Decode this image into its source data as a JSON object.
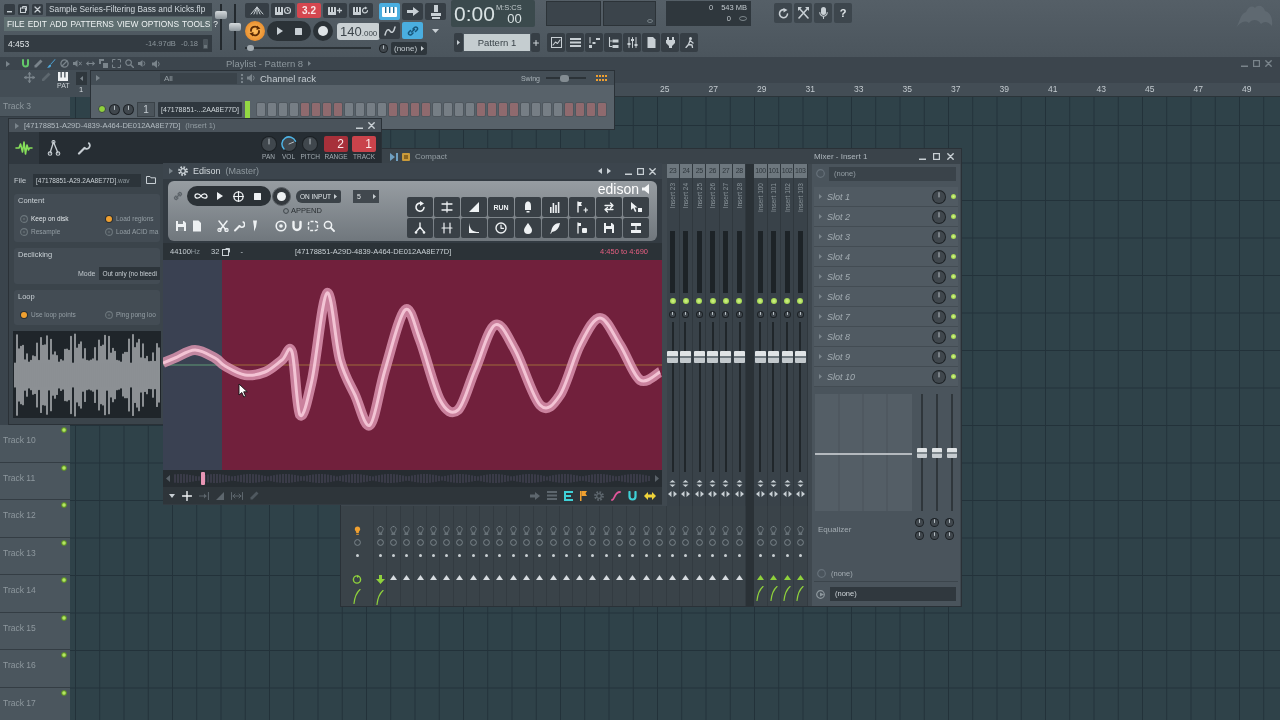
{
  "main_window": {
    "title": "Sample Series-Filtering Bass and Kicks.flp",
    "menu": [
      "FILE",
      "EDIT",
      "ADD",
      "PATTERNS",
      "VIEW",
      "OPTIONS",
      "TOOLS",
      "?"
    ],
    "hint": {
      "position": "4:453",
      "reading": "-14.97dB",
      "value": "-0.18"
    },
    "master_volume": {
      "level": 0.82
    },
    "master_pitch": {
      "level": 0.5
    }
  },
  "transport": {
    "buttons": [
      {
        "kind": "wave",
        "active": false
      },
      {
        "kind": "wait",
        "active": false
      },
      {
        "kind": "countdown",
        "label": "3.2",
        "active": true
      },
      {
        "kind": "step",
        "active": false
      },
      {
        "kind": "loop-record",
        "active": false
      }
    ],
    "mode": {
      "active": true
    },
    "tempo": "140",
    "tempo_fraction": ".000",
    "song_position": {
      "level": 0.02
    }
  },
  "tools": {
    "buttons": [
      {
        "kind": "keyboard",
        "active": true
      },
      {
        "kind": "arrow",
        "active": false
      },
      {
        "kind": "stamp",
        "active": false
      },
      {
        "kind": "curve",
        "active": false
      },
      {
        "kind": "link",
        "active": true
      }
    ],
    "snap": "(none)"
  },
  "time": {
    "value": "0:00",
    "fraction": "00",
    "unit": "M:S:CS"
  },
  "pattern": {
    "name": "Pattern 1"
  },
  "monitor": {
    "cpu": "0",
    "memory": "543 MB",
    "polyphony": "0"
  },
  "help_button": "?",
  "playlist": {
    "title": "Playlist - Pattern 8",
    "pattern_label": "PAT",
    "pattern_number": "1",
    "bars": [
      "25",
      "27",
      "29",
      "31",
      "33",
      "35",
      "37",
      "39",
      "41",
      "43",
      "45",
      "47",
      "49"
    ],
    "tracks": [
      {
        "name": "Track 3"
      },
      {
        "name": "Track 10",
        "enabled": true
      },
      {
        "name": "Track 11",
        "enabled": true
      },
      {
        "name": "Track 12",
        "enabled": true
      },
      {
        "name": "Track 13",
        "enabled": true
      },
      {
        "name": "Track 14",
        "enabled": true
      },
      {
        "name": "Track 15",
        "enabled": true
      },
      {
        "name": "Track 16",
        "enabled": true
      },
      {
        "name": "Track 17",
        "enabled": true
      }
    ]
  },
  "channel_rack": {
    "title": "Channel rack",
    "filter": "All",
    "swing": {
      "label": "Swing",
      "level": 0.45
    },
    "channels": [
      {
        "on": true,
        "insert": "1",
        "name": "[47178851-...2AA8E77D]",
        "selected": true,
        "steps": [
          false,
          false,
          false,
          false,
          false,
          false,
          false,
          false,
          false,
          false,
          false,
          false,
          false,
          false,
          false,
          false,
          false,
          false,
          false,
          false,
          false,
          false,
          false,
          false,
          false,
          false,
          false,
          false,
          false,
          false,
          false,
          false
        ]
      }
    ]
  },
  "sampler": {
    "title": "[47178851-A29D-4839-A464-DE012AA8E77D]",
    "route": "(Insert 1)",
    "tabs": [
      {
        "selected": true
      },
      {
        "selected": false
      },
      {
        "selected": false
      }
    ],
    "knobs": [
      {
        "label": "PAN"
      },
      {
        "label": "VOL",
        "level": 0.75
      },
      {
        "label": "PITCH"
      }
    ],
    "displays": [
      {
        "value": "2",
        "label": "RANGE"
      },
      {
        "value": "1",
        "label": "TRACK"
      }
    ],
    "file": {
      "label": "File",
      "name": "[47178851-A29.2AA8E77D]",
      "ext": ".wav"
    },
    "sections": [
      {
        "kind": "options",
        "title": "Content",
        "options": [
          {
            "label": "Keep on disk",
            "checked": false,
            "disabled": false
          },
          {
            "label": "Load regions",
            "checked": true,
            "disabled": true
          },
          {
            "label": "Resample",
            "checked": false,
            "disabled": true
          },
          {
            "label": "Load ACID ma",
            "checked": false,
            "disabled": true
          }
        ]
      },
      {
        "kind": "mode",
        "title": "Declicking",
        "label": "Mode",
        "value": "Out only (no bleedi"
      },
      {
        "kind": "options",
        "title": "Loop",
        "options": [
          {
            "label": "Use loop points",
            "checked": true,
            "disabled": true
          },
          {
            "label": "Ping pong loo",
            "checked": false,
            "disabled": true
          }
        ]
      }
    ]
  },
  "edison": {
    "title": "Edison",
    "subtitle": "(Master)",
    "record_mode": "ON INPUT",
    "pre_value": "5",
    "append": {
      "label": "APPEND",
      "checked": false
    },
    "logo": "edison",
    "script_button": "RUN",
    "info": {
      "rate": "44100",
      "rate_unit": "Hz",
      "format": "32",
      "tempo": "-",
      "title": "[47178851-A29D-4839-A464-DE012AA8E77D]",
      "selection": "4:450 to 4:690"
    }
  },
  "mixer": {
    "title": "Mixer - Insert 1",
    "view": "Compact",
    "master": {
      "armed": true,
      "routed": true
    },
    "inserts": [
      {
        "selected": true,
        "routed": false
      },
      {
        "selected": false,
        "routed": false
      },
      {
        "selected": false,
        "routed": false
      },
      {
        "selected": false,
        "routed": false
      },
      {
        "selected": false,
        "routed": false
      },
      {
        "selected": false,
        "routed": false
      },
      {
        "selected": false,
        "routed": false
      },
      {
        "selected": false,
        "routed": false
      },
      {
        "selected": false,
        "routed": false
      },
      {
        "selected": false,
        "routed": false
      },
      {
        "selected": false,
        "routed": false
      },
      {
        "selected": false,
        "routed": false
      },
      {
        "selected": false,
        "routed": false
      },
      {
        "selected": false,
        "routed": false
      },
      {
        "selected": false,
        "routed": false
      },
      {
        "selected": false,
        "routed": false
      },
      {
        "selected": false,
        "routed": false
      },
      {
        "selected": false,
        "routed": false
      },
      {
        "selected": false,
        "routed": false
      },
      {
        "selected": false,
        "routed": false
      },
      {
        "selected": false,
        "routed": false
      },
      {
        "selected": false,
        "routed": false
      },
      {
        "number": "23",
        "name": "Insert 23",
        "on": true,
        "level": 0.79,
        "selected": false,
        "routed": false
      },
      {
        "number": "24",
        "name": "Insert 24",
        "on": true,
        "level": 0.79,
        "selected": false,
        "routed": false
      },
      {
        "number": "25",
        "name": "Insert 25",
        "on": true,
        "level": 0.79,
        "selected": false,
        "routed": false
      },
      {
        "number": "26",
        "name": "Insert 26",
        "on": true,
        "level": 0.79,
        "selected": false,
        "routed": false
      },
      {
        "number": "27",
        "name": "Insert 27",
        "on": true,
        "level": 0.79,
        "selected": false,
        "routed": false
      },
      {
        "number": "28",
        "name": "Insert 28",
        "on": true,
        "level": 0.79,
        "selected": false,
        "routed": false
      }
    ],
    "extra_inserts": [
      {
        "number": "100",
        "name": "Insert 100",
        "on": true,
        "level": 0.79,
        "selected": false,
        "routed": true
      },
      {
        "number": "101",
        "name": "Insert 101",
        "on": true,
        "level": 0.79,
        "selected": false,
        "routed": true
      },
      {
        "number": "102",
        "name": "Insert 102",
        "on": true,
        "level": 0.79,
        "selected": false,
        "routed": true
      },
      {
        "number": "103",
        "name": "Insert 103",
        "on": true,
        "level": 0.79,
        "selected": false,
        "routed": true
      }
    ],
    "input": "(none)",
    "slots": [
      {
        "name": "Slot 1",
        "on": true
      },
      {
        "name": "Slot 2",
        "on": true
      },
      {
        "name": "Slot 3",
        "on": true
      },
      {
        "name": "Slot 4",
        "on": true
      },
      {
        "name": "Slot 5",
        "on": true
      },
      {
        "name": "Slot 6",
        "on": true
      },
      {
        "name": "Slot 7",
        "on": true
      },
      {
        "name": "Slot 8",
        "on": true
      },
      {
        "name": "Slot 9",
        "on": true
      },
      {
        "name": "Slot 10",
        "on": true
      }
    ],
    "eq_bands": [
      {
        "level": 0.5
      },
      {
        "level": 0.5
      },
      {
        "level": 0.5
      }
    ],
    "eq_label": "Equalizer",
    "send": "(none)",
    "output": "(none)"
  }
}
